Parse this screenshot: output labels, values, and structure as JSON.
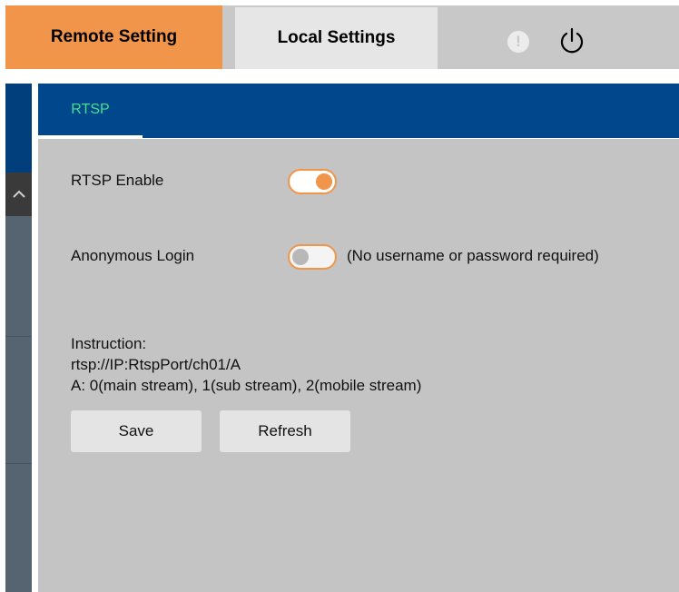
{
  "top_tabs": {
    "remote_setting": "Remote Setting",
    "local_settings": "Local Settings"
  },
  "top_icons": {
    "alert_glyph": "!",
    "alert_icon": "exclamation-circle-icon",
    "power_icon": "power-icon"
  },
  "sidebar": {
    "scroll_up_icon": "chevron-up-icon"
  },
  "section_tab": {
    "label": "RTSP"
  },
  "rtsp_enable": {
    "label": "RTSP Enable",
    "enabled": true
  },
  "anonymous_login": {
    "label": "Anonymous Login",
    "enabled": false,
    "note": "(No username or password required)"
  },
  "instruction": {
    "heading": "Instruction:",
    "url_format": "rtsp://IP:RtspPort/ch01/A",
    "stream_legend": "A: 0(main stream), 1(sub stream), 2(mobile stream)"
  },
  "buttons": {
    "save": "Save",
    "refresh": "Refresh"
  },
  "colors": {
    "accent_orange": "#f0954a",
    "header_blue": "#00478c",
    "tab_active_text": "#44e08e",
    "content_bg": "#c4c4c4"
  }
}
